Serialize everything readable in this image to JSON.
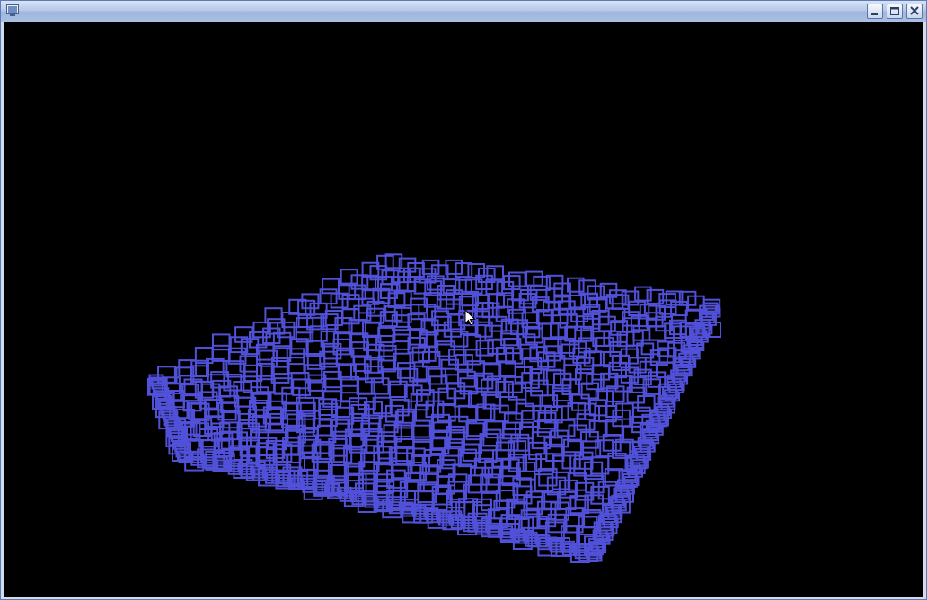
{
  "window": {
    "title": "",
    "controls": [
      "minimize",
      "maximize",
      "close"
    ]
  },
  "scene": {
    "background_color": "#000000",
    "square_color": "#5050d8",
    "grid_columns": 30,
    "grid_rows": 24
  }
}
